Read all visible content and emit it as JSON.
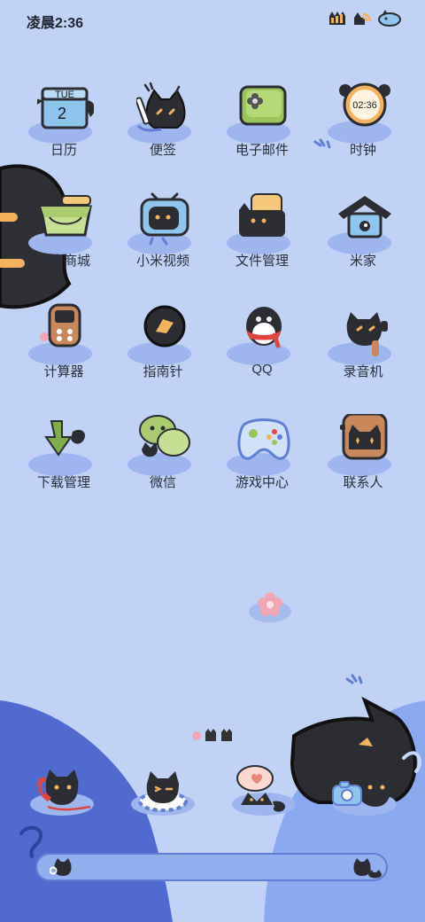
{
  "status": {
    "time": "凌晨2:36"
  },
  "clock_widget": {
    "time": "02:36"
  },
  "calendar_widget": {
    "weekday": "TUE",
    "day": "2"
  },
  "apps": [
    {
      "label": "日历",
      "icon": "calendar-icon"
    },
    {
      "label": "便签",
      "icon": "notes-icon"
    },
    {
      "label": "电子邮件",
      "icon": "email-icon"
    },
    {
      "label": "时钟",
      "icon": "clock-icon"
    },
    {
      "label": "小米商城",
      "icon": "mi-store-icon"
    },
    {
      "label": "小米视频",
      "icon": "mi-video-icon"
    },
    {
      "label": "文件管理",
      "icon": "file-manager-icon"
    },
    {
      "label": "米家",
      "icon": "mi-home-icon"
    },
    {
      "label": "计算器",
      "icon": "calculator-icon"
    },
    {
      "label": "指南针",
      "icon": "compass-icon"
    },
    {
      "label": "QQ",
      "icon": "qq-icon"
    },
    {
      "label": "录音机",
      "icon": "recorder-icon"
    },
    {
      "label": "下载管理",
      "icon": "download-manager-icon"
    },
    {
      "label": "微信",
      "icon": "wechat-icon"
    },
    {
      "label": "游戏中心",
      "icon": "game-center-icon"
    },
    {
      "label": "联系人",
      "icon": "contacts-icon"
    }
  ],
  "dock": [
    {
      "icon": "phone-icon"
    },
    {
      "icon": "messages-icon"
    },
    {
      "icon": "browser-icon"
    },
    {
      "icon": "camera-icon"
    }
  ],
  "colors": {
    "background": "#c0d2f6",
    "accent": "#5e7fd3",
    "ink": "#222222"
  }
}
